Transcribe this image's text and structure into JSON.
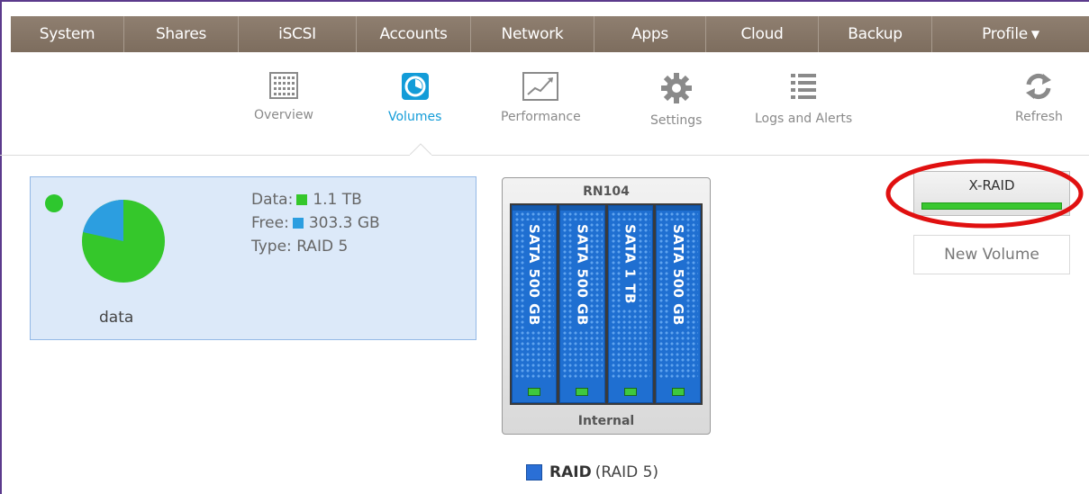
{
  "topnav": {
    "tabs": [
      {
        "label": "System",
        "active": true
      },
      {
        "label": "Shares"
      },
      {
        "label": "iSCSI"
      },
      {
        "label": "Accounts"
      },
      {
        "label": "Network"
      },
      {
        "label": "Apps"
      },
      {
        "label": "Cloud"
      },
      {
        "label": "Backup"
      },
      {
        "label": "Profile"
      }
    ],
    "active_color": "#139cd8",
    "tab_color": "#8a7a6b"
  },
  "subnav": {
    "overview": "Overview",
    "volumes": "Volumes",
    "performance": "Performance",
    "settings": "Settings",
    "logs": "Logs and Alerts",
    "refresh": "Refresh",
    "active": "Volumes"
  },
  "volume": {
    "name": "data",
    "data_label": "Data:",
    "data_value": "1.1 TB",
    "free_label": "Free:",
    "free_value": "303.3 GB",
    "type_label": "Type:",
    "type_value": "RAID 5",
    "used_fraction": 0.785,
    "data_color": "#35c72b",
    "free_color": "#2c9ee0",
    "status_color": "#2ec72e"
  },
  "chassis": {
    "model": "RN104",
    "location": "Internal",
    "drives": [
      "SATA 500 GB",
      "SATA 500 GB",
      "SATA 1 TB",
      "SATA 500 GB"
    ]
  },
  "raid_legend": {
    "name": "RAID",
    "level": "(RAID 5)",
    "color": "#2a6fd6"
  },
  "buttons": {
    "xraid": "X-RAID",
    "new_volume": "New Volume"
  }
}
